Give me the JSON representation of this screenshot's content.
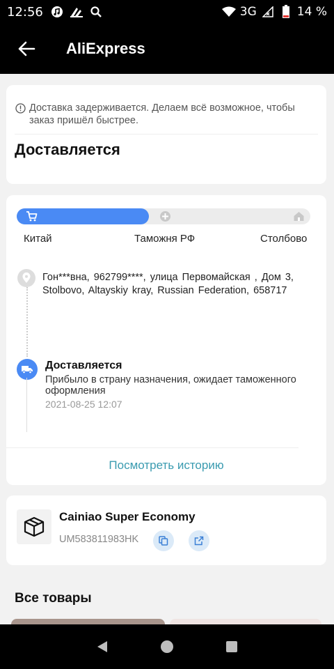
{
  "status_bar": {
    "time": "12:56",
    "network": "3G",
    "battery": "14 %"
  },
  "app_bar": {
    "title": "AliExpress"
  },
  "notice": {
    "text": "Доставка задерживается. Делаем всё возможное, чтобы заказ пришёл быстрее."
  },
  "order_status": {
    "title": "Доставляется"
  },
  "progress": {
    "fraction": 0.45,
    "stages": [
      "Китай",
      "Таможня РФ",
      "Столбово"
    ]
  },
  "address": {
    "text": "Гон***вна,  962799****,  улица Первомайская , Дом 3,  Stolbovo,  Altayskiy kray,  Russian Federation,  658717"
  },
  "event": {
    "title": "Доставляется",
    "description": "Прибыло в страну назначения, ожидает таможенного оформления",
    "time": "2021-08-25 12:07"
  },
  "history_link": "Посмотреть историю",
  "shipment": {
    "carrier": "Cainiao Super Economy",
    "tracking_number": "UM583811983HK"
  },
  "section_title": "Все товары",
  "colors": {
    "accent": "#4a8af4",
    "link": "#3a9bb0",
    "status_bar": "#000000"
  }
}
